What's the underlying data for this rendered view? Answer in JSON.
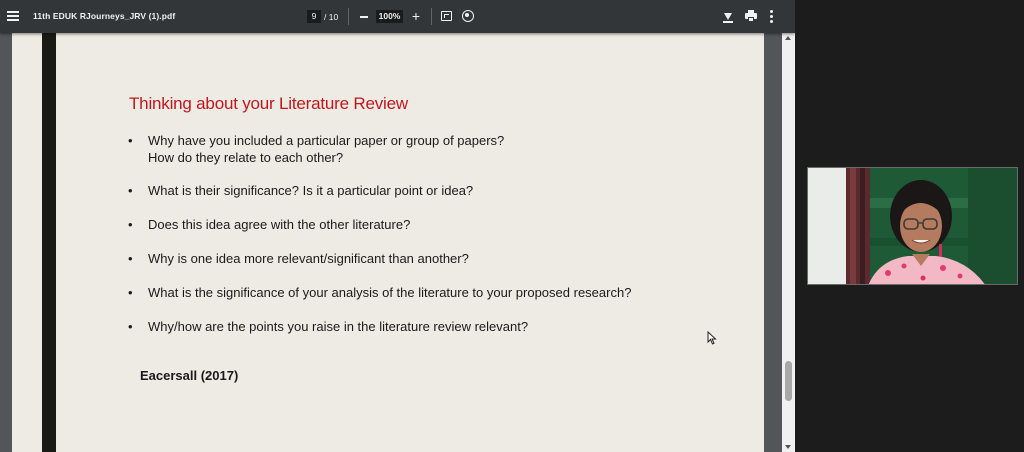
{
  "toolbar": {
    "menu_icon": "hamburger-menu-icon",
    "title": "11th EDUK RJourneys_JRV (1).pdf",
    "current_page": "9",
    "total_pages": "/ 10",
    "zoom": "100%",
    "zoom_out_symbol": "−",
    "zoom_in_symbol": "+"
  },
  "slide": {
    "title": "Thinking about your Literature Review",
    "bullet_symbol": "•",
    "bullets": [
      {
        "line1": "Why have you included a particular paper or group of papers?",
        "line2": "How do they relate to each other?"
      },
      {
        "line1": "What is their significance?  Is it a particular point or idea?"
      },
      {
        "line1": "Does this idea agree with the other literature?"
      },
      {
        "line1": "Why is one idea more relevant/significant than another?"
      },
      {
        "line1": "What is the significance of your analysis of the literature to your proposed research?"
      },
      {
        "line1": "Why/how are the points you raise in the literature review relevant?"
      }
    ],
    "citation": "Eacersall (2017)"
  },
  "colors": {
    "toolbar_bg": "#323639",
    "viewer_bg": "#525659",
    "page_bg": "#eeebe4",
    "title_red": "#c0171e",
    "page_bar": "#1a1a14"
  }
}
